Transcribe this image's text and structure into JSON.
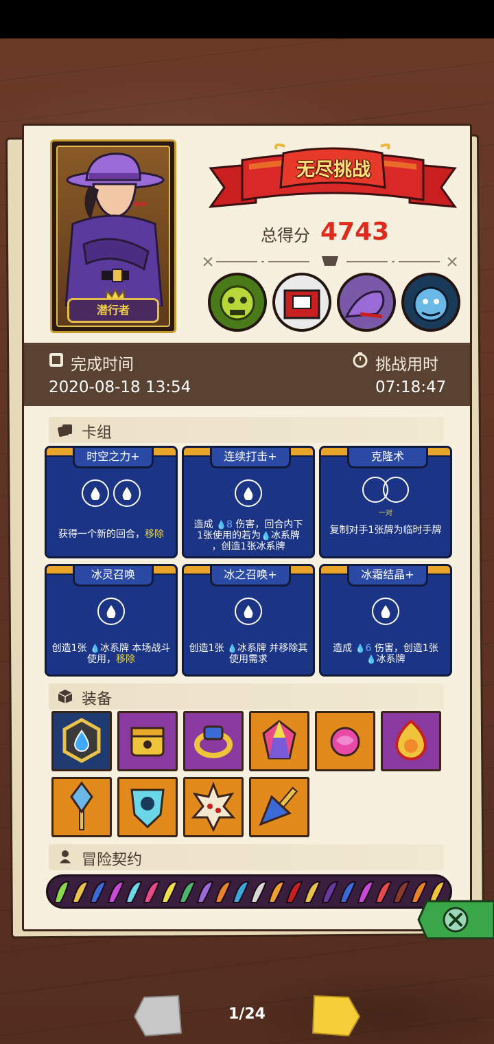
{
  "title": "无尽挑战",
  "score": {
    "label": "总得分",
    "value": "4743"
  },
  "hero": {
    "name": "潜行者"
  },
  "completion": {
    "label": "完成时间",
    "value": "2020-08-18 13:54"
  },
  "duration": {
    "label": "挑战用时",
    "value": "07:18:47"
  },
  "sections": {
    "deck": "卡组",
    "equipment": "装备",
    "contracts": "冒险契约"
  },
  "cards": [
    {
      "title": "时空之力+",
      "orbs": 2,
      "desc_a": "获得一个新的回合，",
      "desc_b": "移除",
      "desc_c": ""
    },
    {
      "title": "连续打击+",
      "orbs": 1,
      "line1_a": "造成 ",
      "line1_num": "8",
      "line1_b": " 伤害，回合内下",
      "line2_a": "1张使用的若为",
      "line2_b": "冰系牌",
      "line3": "，创造1张冰系牌"
    },
    {
      "title": "克隆术",
      "sub": "一对",
      "desc": "复制对手1张牌为临时手牌"
    },
    {
      "title": "冰灵召唤",
      "orbs": 1,
      "d1": "创造1张 ",
      "d2": "冰系牌 本场战斗使用，",
      "d3": "移除"
    },
    {
      "title": "冰之召唤+",
      "orbs": 1,
      "d1": "创造1张 ",
      "d2": "冰系牌 并移除其使用需求"
    },
    {
      "title": "冰霜结晶+",
      "orbs": 1,
      "d1": "造成 ",
      "num": "6",
      "d2": " 伤害，创造1张",
      "d3": "冰系牌"
    }
  ],
  "equipment": [
    {
      "name": "water-gem-amulet-icon",
      "color": "blue"
    },
    {
      "name": "golden-box-icon",
      "color": "purple"
    },
    {
      "name": "ring-icon",
      "color": "purple"
    },
    {
      "name": "crystal-icon",
      "color": "orange"
    },
    {
      "name": "pink-orb-icon",
      "color": "orange"
    },
    {
      "name": "fire-orb-icon",
      "color": "purple"
    },
    {
      "name": "blue-scepter-icon",
      "color": "orange"
    },
    {
      "name": "skull-shield-icon",
      "color": "orange"
    },
    {
      "name": "spiked-ball-icon",
      "color": "orange"
    },
    {
      "name": "dagger-icon",
      "color": "orange"
    }
  ],
  "pager": {
    "text": "1/24"
  }
}
